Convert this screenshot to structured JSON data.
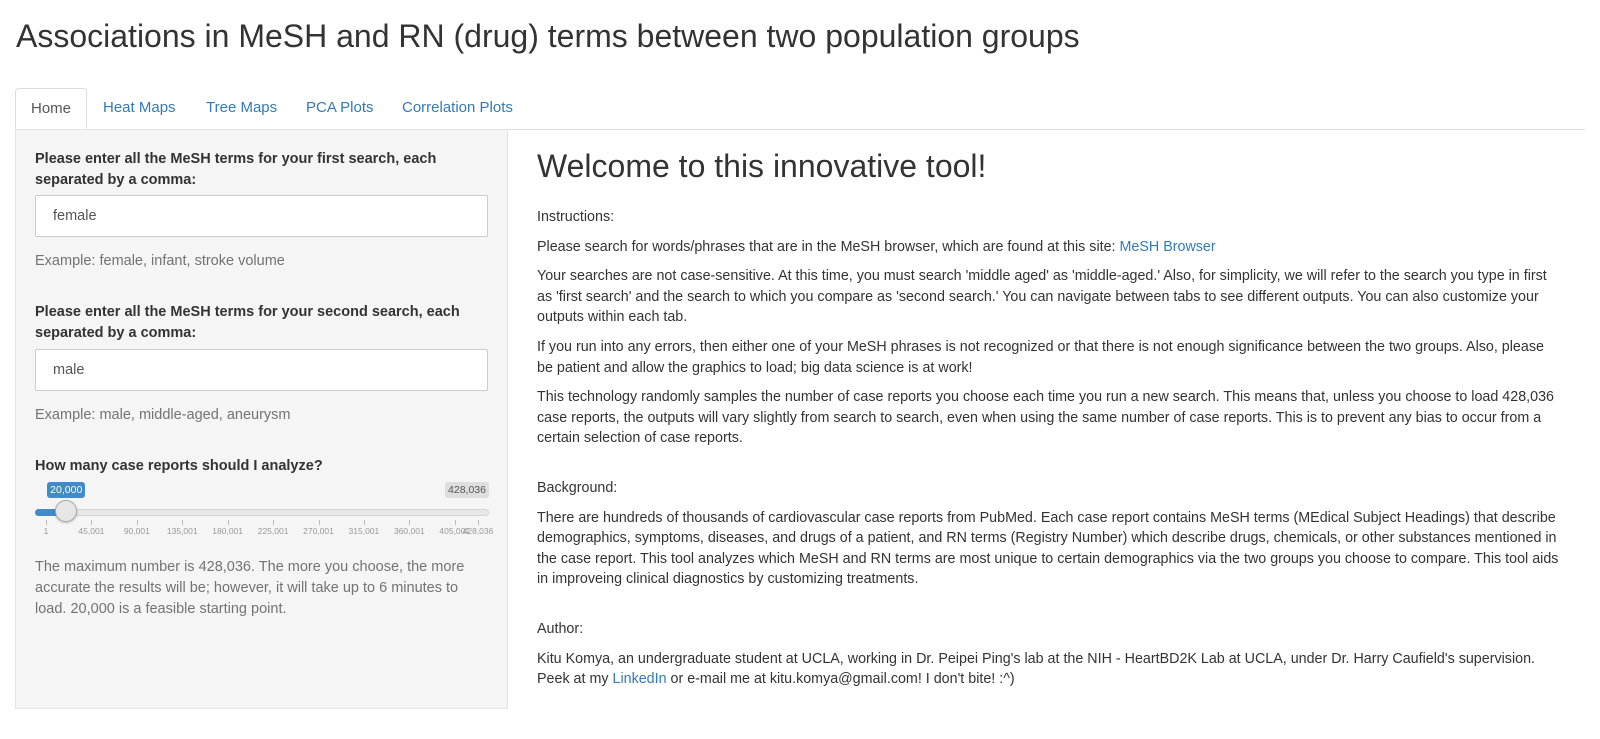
{
  "page": {
    "title": "Associations in MeSH and RN (drug) terms between two population groups"
  },
  "tabs": [
    {
      "label": "Home",
      "active": true
    },
    {
      "label": "Heat Maps",
      "active": false
    },
    {
      "label": "Tree Maps",
      "active": false
    },
    {
      "label": "PCA Plots",
      "active": false
    },
    {
      "label": "Correlation Plots",
      "active": false
    }
  ],
  "sidebar": {
    "first_search": {
      "label": "Please enter all the MeSH terms for your first search, each separated by a comma:",
      "value": "female",
      "help": "Example: female, infant, stroke volume"
    },
    "second_search": {
      "label": "Please enter all the MeSH terms for your second search, each separated by a comma:",
      "value": "male",
      "help": "Example: male, middle-aged, aneurysm"
    },
    "case_reports": {
      "label": "How many case reports should I analyze?",
      "value_label": "20,000",
      "max_label": "428,036",
      "min": 1,
      "max": 428036,
      "value": 20000,
      "ticks": [
        "1",
        "45,001",
        "90,001",
        "135,001",
        "180,001",
        "225,001",
        "270,001",
        "315,001",
        "360,001",
        "405,001",
        "428,036"
      ],
      "help": "The maximum number is 428,036. The more you choose, the more accurate the results will be; however, it will take up to 6 minutes to load. 20,000 is a feasible starting point."
    }
  },
  "main": {
    "welcome": "Welcome to this innovative tool!",
    "instructions_heading": "Instructions:",
    "p1_text": "Please search for words/phrases that are in the MeSH browser, which are found at this site: ",
    "p1_link": "MeSH Browser",
    "p2": "Your searches are not case-sensitive. At this time, you must search 'middle aged' as 'middle-aged.' Also, for simplicity, we will refer to the search you type in first as 'first search' and the search to which you compare as 'second search.' You can navigate between tabs to see different outputs. You can also customize your outputs within each tab.",
    "p3": "If you run into any errors, then either one of your MeSH phrases is not recognized or that there is not enough significance between the two groups. Also, please be patient and allow the graphics to load; big data science is at work!",
    "p4": "This technology randomly samples the number of case reports you choose each time you run a new search. This means that, unless you choose to load 428,036 case reports, the outputs will vary slightly from search to search, even when using the same number of case reports. This is to prevent any bias to occur from a certain selection of case reports.",
    "background_heading": "Background:",
    "p5": "There are hundreds of thousands of cardiovascular case reports from PubMed. Each case report contains MeSH terms (MEdical Subject Headings) that describe demographics, symptoms, diseases, and drugs of a patient, and RN terms (Registry Number) which describe drugs, chemicals, or other substances mentioned in the case report. This tool analyzes which MeSH and RN terms are most unique to certain demographics via the two groups you choose to compare. This tool aids in improveing clinical diagnostics by customizing treatments.",
    "author_heading": "Author:",
    "p6_text": "Kitu Komya, an undergraduate student at UCLA, working in Dr. Peipei Ping's lab at the NIH - HeartBD2K Lab at UCLA, under Dr. Harry Caufield's supervision. Peek at my ",
    "p6_link": "LinkedIn",
    "p6_tail": " or e-mail me at kitu.komya@gmail.com! I don't bite! :^)"
  }
}
